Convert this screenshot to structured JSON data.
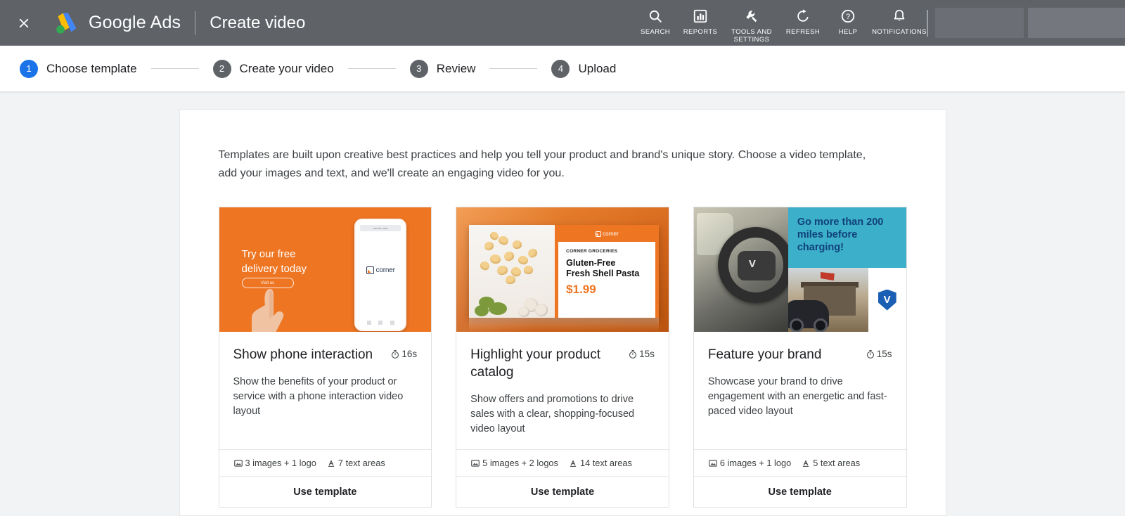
{
  "topbar": {
    "close_icon": "close-icon",
    "brand": "Google Ads",
    "brand_google": "Google",
    "brand_ads": "Ads",
    "page_title": "Create video",
    "actions": [
      {
        "icon": "search-icon",
        "label": "SEARCH"
      },
      {
        "icon": "reports-bar-chart-icon",
        "label": "REPORTS"
      },
      {
        "icon": "wrench-tools-icon",
        "label": "TOOLS AND\nSETTINGS"
      },
      {
        "icon": "refresh-icon",
        "label": "REFRESH"
      },
      {
        "icon": "help-question-icon",
        "label": "HELP"
      },
      {
        "icon": "bell-notifications-icon",
        "label": "NOTIFICATIONS"
      }
    ]
  },
  "stepper": {
    "steps": [
      {
        "number": "1",
        "label": "Choose template",
        "active": true
      },
      {
        "number": "2",
        "label": "Create your video",
        "active": false
      },
      {
        "number": "3",
        "label": "Review",
        "active": false
      },
      {
        "number": "4",
        "label": "Upload",
        "active": false
      }
    ]
  },
  "main": {
    "intro": "Templates are built upon creative best practices and help you tell your product and brand's unique story. Choose a video template, add your images and text, and we'll create an engaging video for you.",
    "cards": [
      {
        "title": "Show phone interaction",
        "duration": "16s",
        "duration_icon": "timer-icon",
        "description": "Show the benefits of your product or service with a phone interaction video layout",
        "images_meta": "3 images + 1 logo",
        "images_icon": "image-icon",
        "text_meta": "7 text areas",
        "text_icon": "text-format-icon",
        "action_label": "Use template",
        "thumbnail": {
          "kind": "phone-interaction",
          "headline": "Try our free\ndelivery today",
          "cta": "Visit us",
          "phone_url": "corner.com",
          "brand_word": "corner",
          "bg_color": "#ee7623"
        }
      },
      {
        "title": "Highlight your product catalog",
        "duration": "15s",
        "duration_icon": "timer-icon",
        "description": "Show offers and promotions to drive sales with a clear, shopping-focused video layout",
        "images_meta": "5 images + 2 logos",
        "images_icon": "image-icon",
        "text_meta": "14 text areas",
        "text_icon": "text-format-icon",
        "action_label": "Use template",
        "thumbnail": {
          "kind": "product-catalog",
          "brand_word": "corner",
          "eyebrow": "CORNER GROCERIES",
          "product_name": "Gluten-Free\nFresh Shell Pasta",
          "price": "$1.99",
          "bg_color": "#d2641a",
          "accent_color": "#ee7623"
        }
      },
      {
        "title": "Feature your brand",
        "duration": "15s",
        "duration_icon": "timer-icon",
        "description": "Showcase your brand to drive engagement with an energetic and fast-paced video layout",
        "images_meta": "6 images + 1 logo",
        "images_icon": "image-icon",
        "text_meta": "5 text areas",
        "text_icon": "text-format-icon",
        "action_label": "Use template",
        "thumbnail": {
          "kind": "feature-brand",
          "headline": "Go more than 200 miles before charging!",
          "panel_color": "#3cafca",
          "headline_color": "#11427a",
          "logo_letter": "V"
        }
      }
    ]
  },
  "colors": {
    "topbar_bg": "#5f6368",
    "accent_blue": "#1a73e8",
    "step_inactive": "#5f6368",
    "page_bg": "#f1f3f4",
    "panel_bg": "#ffffff"
  }
}
